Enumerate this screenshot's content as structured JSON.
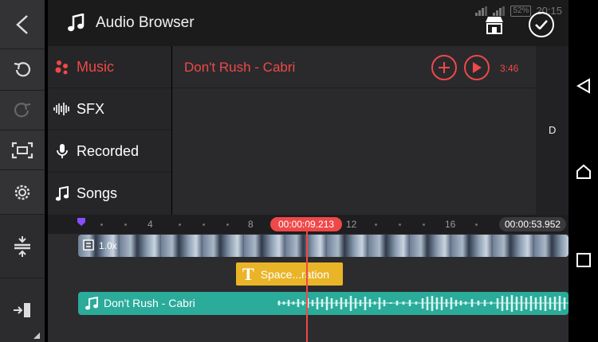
{
  "header": {
    "title": "Audio Browser"
  },
  "status": {
    "battery": "52%",
    "time": "20:15"
  },
  "categories": [
    {
      "label": "Music",
      "icon": "music-dots-icon",
      "active": true
    },
    {
      "label": "SFX",
      "icon": "waveform-icon",
      "active": false
    },
    {
      "label": "Recorded",
      "icon": "microphone-icon",
      "active": false
    },
    {
      "label": "Songs",
      "icon": "music-note-icon",
      "active": false
    }
  ],
  "tracks": [
    {
      "title": "Don't Rush - Cabri",
      "duration": "3:46"
    }
  ],
  "index": {
    "letter": "D"
  },
  "timeline": {
    "ruler_labels": [
      "4",
      "8",
      "12",
      "16"
    ],
    "current_time": "00:00:09.213",
    "total_time": "00:00:53.952",
    "video_clip": {
      "speed": "1.0x"
    },
    "text_clip": {
      "label": "Space...ration"
    },
    "audio_clip": {
      "label": "Don't Rush - Cabri"
    }
  },
  "colors": {
    "accent": "#f04848",
    "audio": "#2bab9a",
    "text_clip": "#e9b427",
    "marker": "#8a4dff"
  }
}
